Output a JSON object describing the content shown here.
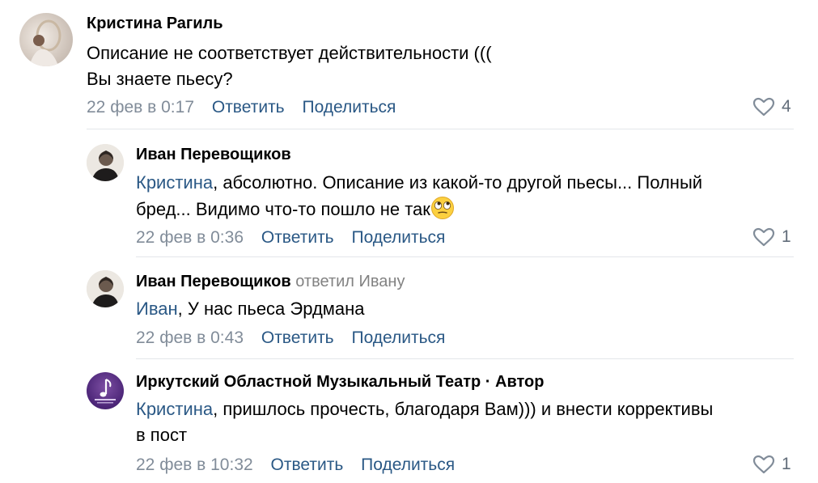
{
  "comments": [
    {
      "author": "Кристина Рагиль",
      "text_lines": [
        "Описание не соответствует действительности (((",
        "Вы знаете пьесу?"
      ],
      "time": "22 фев в 0:17",
      "reply_label": "Ответить",
      "share_label": "Поделиться",
      "likes": "4"
    },
    {
      "author": "Иван Перевощиков",
      "mention": "Кристина",
      "text_line1": ", абсолютно. Описание из какой-то другой пьесы... Полный",
      "text_line2": "бред... Видимо что-то пошло не так",
      "time": "22 фев в 0:36",
      "reply_label": "Ответить",
      "share_label": "Поделиться",
      "likes": "1"
    },
    {
      "author": "Иван Перевощиков",
      "replied_to": "ответил Ивану",
      "mention": "Иван",
      "text": ", У нас пьеса Эрдмана",
      "time": "22 фев в 0:43",
      "reply_label": "Ответить",
      "share_label": "Поделиться"
    },
    {
      "author": "Иркутский Областной Музыкальный Театр · Автор",
      "mention": "Кристина",
      "text_line1": ", пришлось прочесть, благодаря Вам))) и внести коррективы",
      "text_line2": "в пост",
      "time": "22 фев в 10:32",
      "reply_label": "Ответить",
      "share_label": "Поделиться",
      "likes": "1"
    }
  ],
  "colors": {
    "link": "#2a5885",
    "meta": "#818c99",
    "divider": "#e3e6ea"
  },
  "icons": [
    "heart-icon",
    "rolling-eyes-emoji"
  ]
}
